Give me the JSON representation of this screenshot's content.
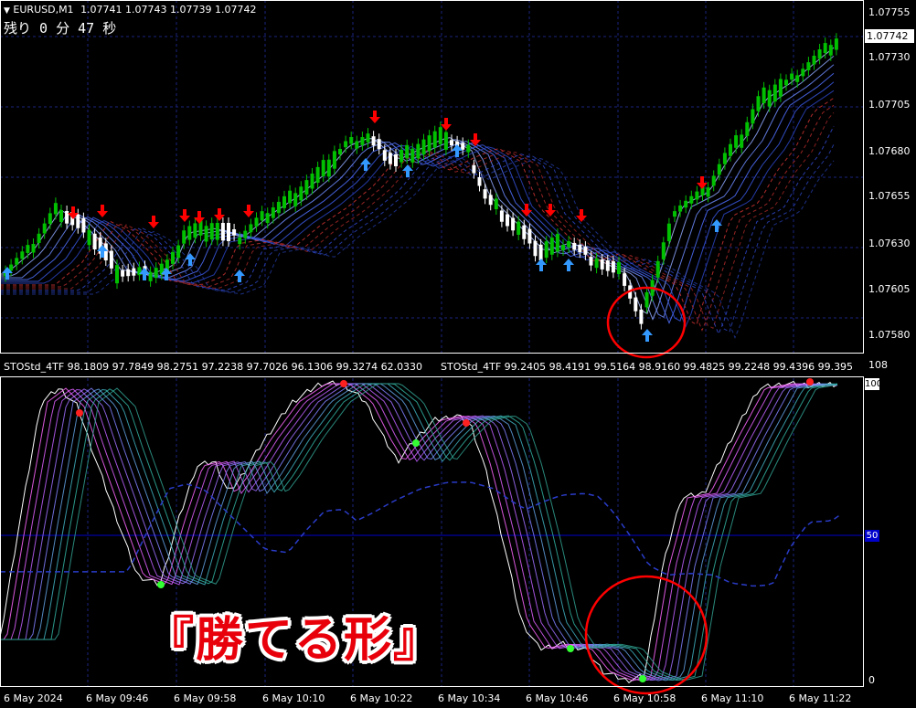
{
  "symbol": {
    "header": "EURUSD,M1",
    "ohlc": "1.07741 1.07743 1.07739 1.07742",
    "menu_icon": "triangle-down-icon"
  },
  "countdown": "残り 0 分 47 秒",
  "price_axis": {
    "ticks": [
      "1.07755",
      "1.07730",
      "1.07705",
      "1.07680",
      "1.07655",
      "1.07630",
      "1.07605",
      "1.07580"
    ],
    "current_price": "1.07742"
  },
  "indicator": {
    "label_1": "STOStd_4TF 98.1809 97.7849 98.2751 97.2238 97.7026 96.1306 99.3274 62.0330",
    "label_2": "STOStd_4TF 99.2405 98.4191 99.5164 98.9160 99.4825 99.2248 99.4396 99.395",
    "max_label": "108",
    "level_100": "100",
    "level_50": "50",
    "min_label": "0"
  },
  "time_axis": {
    "ticks": [
      "6 May 2024",
      "6 May 09:46",
      "6 May 09:58",
      "6 May 10:10",
      "6 May 10:22",
      "6 May 10:34",
      "6 May 10:46",
      "6 May 10:58",
      "6 May 11:10",
      "6 May 11:22"
    ]
  },
  "caption": "『勝てる形』",
  "colors": {
    "bull": "#00c000",
    "bear": "#ffffff",
    "grid": "#1a237e",
    "up_arrow": "#3399ff",
    "down_arrow": "#ff0000",
    "highlight": "#ff0000"
  }
}
